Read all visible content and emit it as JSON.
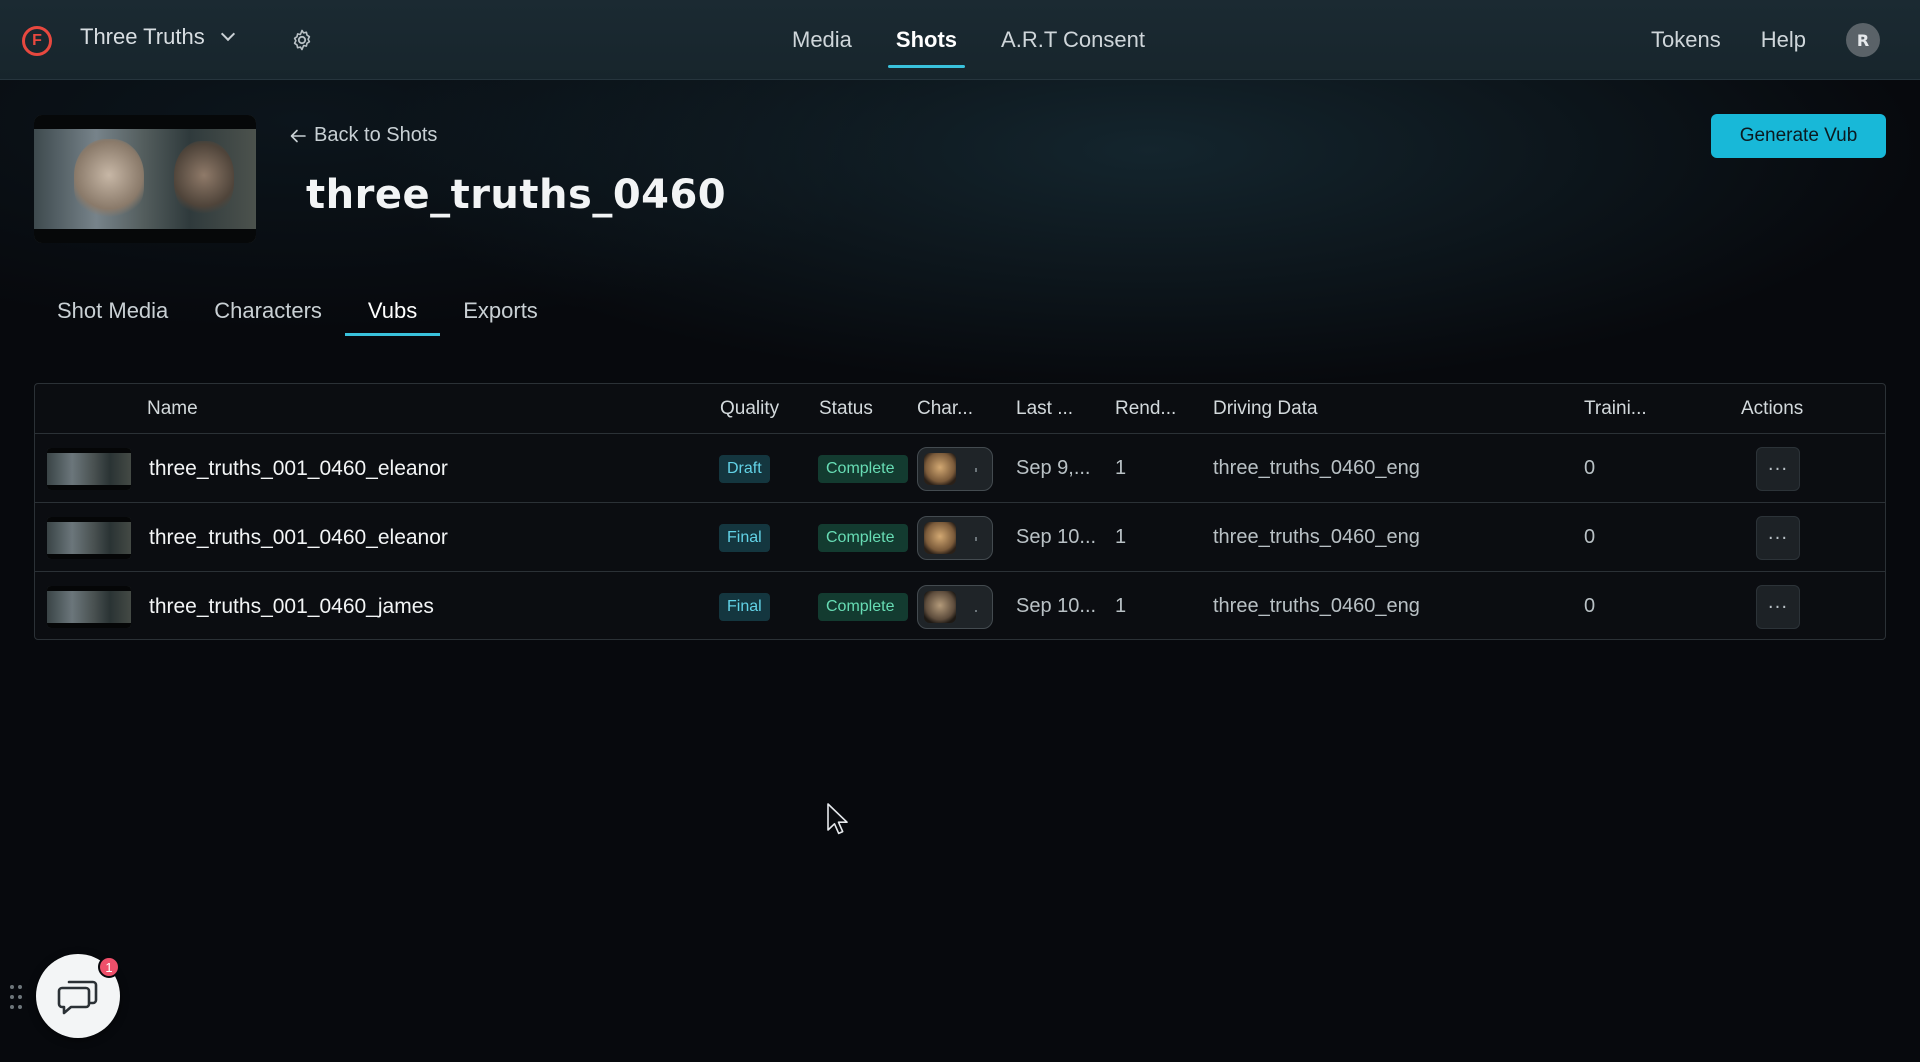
{
  "app": {
    "project_name": "Three Truths",
    "logo_letter": "F"
  },
  "nav": {
    "tabs": [
      {
        "label": "Media"
      },
      {
        "label": "Shots"
      },
      {
        "label": "A.R.T Consent"
      }
    ],
    "active_tab": "Shots",
    "tokens_label": "Tokens",
    "help_label": "Help",
    "avatar_initial": "R"
  },
  "header": {
    "back_label": "Back to Shots",
    "shot_title": "three_truths_0460",
    "generate_button": "Generate Vub"
  },
  "sub_tabs": [
    {
      "label": "Shot Media"
    },
    {
      "label": "Characters"
    },
    {
      "label": "Vubs"
    },
    {
      "label": "Exports"
    }
  ],
  "active_sub_tab": "Vubs",
  "table": {
    "columns": {
      "name": "Name",
      "quality": "Quality",
      "status": "Status",
      "characters": "Char...",
      "last": "Last ...",
      "renders": "Rend...",
      "driving": "Driving Data",
      "training": "Traini...",
      "actions": "Actions"
    },
    "rows": [
      {
        "name": "three_truths_001_0460_eleanor",
        "quality": "Draft",
        "status": "Complete",
        "last": "Sep 9,...",
        "renders": "1",
        "driving": "three_truths_0460_eng",
        "training": "0",
        "more": "···"
      },
      {
        "name": "three_truths_001_0460_eleanor",
        "quality": "Final",
        "status": "Complete",
        "last": "Sep 10...",
        "renders": "1",
        "driving": "three_truths_0460_eng",
        "training": "0",
        "more": "···"
      },
      {
        "name": "three_truths_001_0460_james",
        "quality": "Final",
        "status": "Complete",
        "last": "Sep 10...",
        "renders": "1",
        "driving": "three_truths_0460_eng",
        "training": "0",
        "more": "···"
      }
    ]
  },
  "chat": {
    "badge_count": "1"
  },
  "colors": {
    "accent": "#39c2dc",
    "button": "#18b8d8",
    "logo": "#e8483f",
    "quality_badge": "#62d2e6",
    "status_badge": "#67dcb4"
  }
}
